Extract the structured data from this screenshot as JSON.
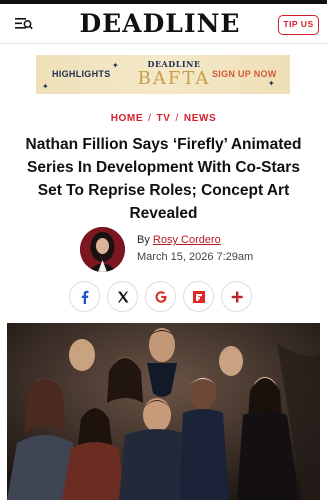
{
  "header": {
    "logo": "DEADLINE",
    "tip_button": "TIP US",
    "menu_icon": "menu-search-icon"
  },
  "banner": {
    "left_text": "HIGHLIGHTS",
    "brand_top": "DEADLINE",
    "brand_main": "BAFTA",
    "cta": "SIGN UP NOW"
  },
  "breadcrumb": {
    "items": [
      "HOME",
      "TV",
      "NEWS"
    ],
    "separator": "/"
  },
  "article": {
    "headline": "Nathan Fillion Says ‘Firefly’ Animated Series In Development With Co-Stars Set To Reprise Roles; Concept Art Revealed",
    "by_prefix": "By",
    "author": "Rosy Cordero",
    "date": "March 15, 2026 7:29am"
  },
  "share": {
    "buttons": [
      "facebook-icon",
      "x-icon",
      "google-icon",
      "flipboard-icon",
      "plus-icon"
    ]
  },
  "colors": {
    "accent_red": "#d21f2a",
    "banner_navy": "#1e2f54",
    "banner_gold": "#c89e4a",
    "banner_cta": "#d2593b"
  }
}
